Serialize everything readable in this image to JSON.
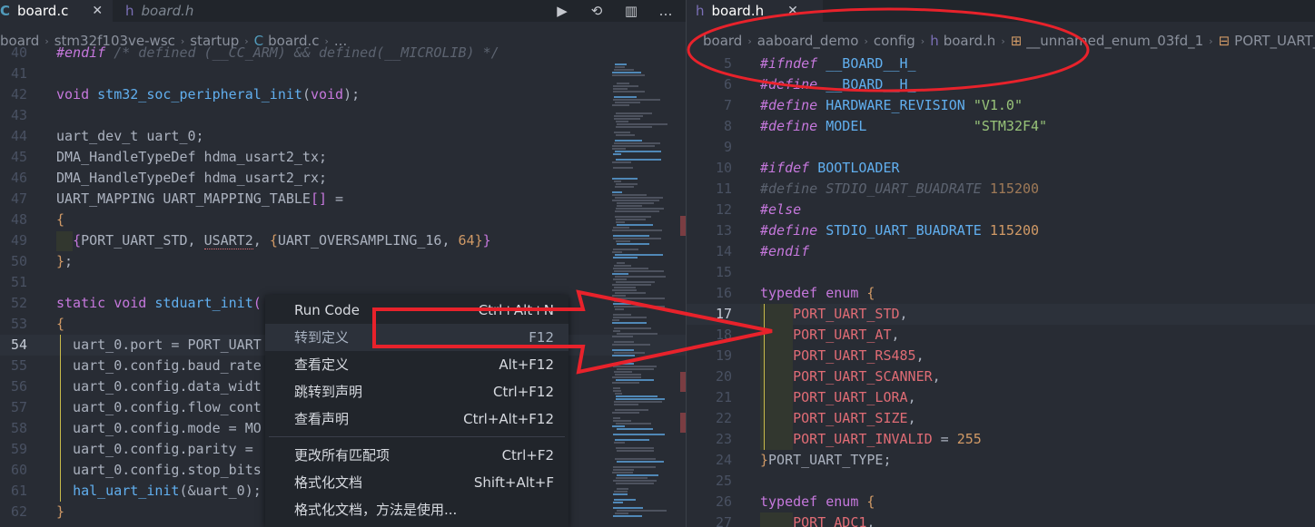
{
  "left": {
    "tabs": [
      {
        "name": "board.c",
        "icon": "C",
        "active": true,
        "close": "✕"
      },
      {
        "name": "board.h",
        "icon": "h",
        "active": false
      }
    ],
    "actions": [
      "▶",
      "⟲",
      "▥",
      "…"
    ],
    "breadcrumb": [
      "board",
      "stm32f103ve-wsc",
      "startup",
      "C",
      "board.c",
      "..."
    ],
    "lines": [
      {
        "n": "40",
        "tokens": [
          [
            "pp",
            "#endif"
          ],
          [
            "cm",
            " /* defined (__CC_ARM) && defined(__MICROLIB) */"
          ]
        ]
      },
      {
        "n": "41",
        "tokens": []
      },
      {
        "n": "42",
        "tokens": [
          [
            "kw",
            "void"
          ],
          [
            "pn",
            " "
          ],
          [
            "fn",
            "stm32_soc_peripheral_init"
          ],
          [
            "pn",
            "("
          ],
          [
            "kw",
            "void"
          ],
          [
            "pn",
            ");"
          ]
        ]
      },
      {
        "n": "43",
        "tokens": []
      },
      {
        "n": "44",
        "tokens": [
          [
            "pn",
            "uart_dev_t uart_0;"
          ]
        ]
      },
      {
        "n": "45",
        "tokens": [
          [
            "pn",
            "DMA_HandleTypeDef hdma_usart2_tx;"
          ]
        ]
      },
      {
        "n": "46",
        "tokens": [
          [
            "pn",
            "DMA_HandleTypeDef hdma_usart2_rx;"
          ]
        ]
      },
      {
        "n": "47",
        "tokens": [
          [
            "pn",
            "UART_MAPPING UART_MAPPING_TABLE"
          ],
          [
            "br",
            "[]"
          ],
          [
            "pn",
            " ="
          ]
        ]
      },
      {
        "n": "48",
        "tokens": [
          [
            "br2",
            "{"
          ]
        ]
      },
      {
        "n": "49",
        "tokens": [
          [
            "pn",
            "  "
          ],
          [
            "br",
            "{"
          ],
          [
            "pn",
            "PORT_UART_STD, "
          ],
          [
            "sq",
            "USART2"
          ],
          [
            "pn",
            ", "
          ],
          [
            "br2",
            "{"
          ],
          [
            "pn",
            "UART_OVERSAMPLING_16, "
          ],
          [
            "num",
            "64"
          ],
          [
            "br2",
            "}"
          ],
          [
            "br",
            "}"
          ]
        ]
      },
      {
        "n": "50",
        "tokens": [
          [
            "br2",
            "}"
          ],
          [
            "pn",
            ";"
          ]
        ]
      },
      {
        "n": "51",
        "tokens": []
      },
      {
        "n": "52",
        "tokens": [
          [
            "kw",
            "static"
          ],
          [
            "pn",
            " "
          ],
          [
            "kw",
            "void"
          ],
          [
            "pn",
            " "
          ],
          [
            "fn",
            "stduart_init"
          ],
          [
            "br",
            "("
          ]
        ]
      },
      {
        "n": "53",
        "tokens": [
          [
            "br2",
            "{"
          ]
        ]
      },
      {
        "n": "54",
        "tokens": [
          [
            "pn",
            "  uart_0.port = PORT_UART"
          ]
        ],
        "cur": true
      },
      {
        "n": "55",
        "tokens": [
          [
            "pn",
            "  uart_0.config.baud_rate"
          ]
        ]
      },
      {
        "n": "56",
        "tokens": [
          [
            "pn",
            "  uart_0.config.data_widt"
          ]
        ]
      },
      {
        "n": "57",
        "tokens": [
          [
            "pn",
            "  uart_0.config.flow_cont"
          ]
        ]
      },
      {
        "n": "58",
        "tokens": [
          [
            "pn",
            "  uart_0.config.mode = MO"
          ]
        ]
      },
      {
        "n": "59",
        "tokens": [
          [
            "pn",
            "  uart_0.config.parity = "
          ]
        ]
      },
      {
        "n": "60",
        "tokens": [
          [
            "pn",
            "  uart_0.config.stop_bits"
          ]
        ]
      },
      {
        "n": "61",
        "tokens": [
          [
            "pn",
            "  "
          ],
          [
            "fn",
            "hal_uart_init"
          ],
          [
            "pn",
            "(&uart_0);"
          ]
        ]
      },
      {
        "n": "62",
        "tokens": [
          [
            "br2",
            "}"
          ]
        ]
      }
    ]
  },
  "menu": {
    "items": [
      {
        "label": "Run Code",
        "key": "Ctrl+Alt+N"
      },
      {
        "label": "转到定义",
        "key": "F12",
        "selected": true
      },
      {
        "label": "查看定义",
        "key": "Alt+F12"
      },
      {
        "label": "跳转到声明",
        "key": "Ctrl+F12"
      },
      {
        "label": "查看声明",
        "key": "Ctrl+Alt+F12"
      },
      {
        "sep": true
      },
      {
        "label": "更改所有匹配项",
        "key": "Ctrl+F2"
      },
      {
        "label": "格式化文档",
        "key": "Shift+Alt+F"
      },
      {
        "label": "格式化文档，方法是使用...",
        "key": ""
      }
    ]
  },
  "right": {
    "tab": {
      "name": "board.h",
      "icon": "h",
      "close": "✕"
    },
    "breadcrumb": [
      "board",
      "aaboard_demo",
      "config",
      "h",
      "board.h",
      "⊞",
      "__unnamed_enum_03fd_1",
      "⊟",
      "PORT_UART_STD"
    ],
    "lines": [
      {
        "n": "5",
        "tokens": [
          [
            "pp",
            "#ifndef"
          ],
          [
            "pn",
            " "
          ],
          [
            "fn",
            "__BOARD__H_"
          ]
        ]
      },
      {
        "n": "6",
        "tokens": [
          [
            "pp",
            "#define"
          ],
          [
            "pn",
            " "
          ],
          [
            "fn",
            "__BOARD__H_"
          ]
        ]
      },
      {
        "n": "7",
        "tokens": [
          [
            "pp",
            "#define"
          ],
          [
            "pn",
            " "
          ],
          [
            "fn",
            "HARDWARE_REVISION"
          ],
          [
            "pn",
            " "
          ],
          [
            "str",
            "\"V1.0\""
          ]
        ]
      },
      {
        "n": "8",
        "tokens": [
          [
            "pp",
            "#define"
          ],
          [
            "pn",
            " "
          ],
          [
            "fn",
            "MODEL"
          ],
          [
            "pn",
            "             "
          ],
          [
            "str",
            "\"STM32F4\""
          ]
        ]
      },
      {
        "n": "9",
        "tokens": []
      },
      {
        "n": "10",
        "tokens": [
          [
            "pp",
            "#ifdef"
          ],
          [
            "pn",
            " "
          ],
          [
            "fn",
            "BOOTLOADER"
          ]
        ]
      },
      {
        "n": "11",
        "tokens": [
          [
            "cmpp",
            "#define STDIO_UART_BUADRATE "
          ],
          [
            "cmnum",
            "115200"
          ]
        ]
      },
      {
        "n": "12",
        "tokens": [
          [
            "pp",
            "#else"
          ]
        ]
      },
      {
        "n": "13",
        "tokens": [
          [
            "pp",
            "#define"
          ],
          [
            "pn",
            " "
          ],
          [
            "fn",
            "STDIO_UART_BUADRATE"
          ],
          [
            "pn",
            " "
          ],
          [
            "num",
            "115200"
          ]
        ]
      },
      {
        "n": "14",
        "tokens": [
          [
            "pp",
            "#endif"
          ]
        ]
      },
      {
        "n": "15",
        "tokens": []
      },
      {
        "n": "16",
        "tokens": [
          [
            "kw",
            "typedef"
          ],
          [
            "pn",
            " "
          ],
          [
            "kw",
            "enum"
          ],
          [
            "pn",
            " "
          ],
          [
            "br2",
            "{"
          ]
        ]
      },
      {
        "n": "17",
        "tokens": [
          [
            "pn",
            "    "
          ],
          [
            "en",
            "PORT_UART_STD"
          ],
          [
            "pn",
            ","
          ]
        ],
        "cur": true
      },
      {
        "n": "18",
        "tokens": [
          [
            "pn",
            "    "
          ],
          [
            "en",
            "PORT_UART_AT"
          ],
          [
            "pn",
            ","
          ]
        ]
      },
      {
        "n": "19",
        "tokens": [
          [
            "pn",
            "    "
          ],
          [
            "en",
            "PORT_UART_RS485"
          ],
          [
            "pn",
            ","
          ]
        ]
      },
      {
        "n": "20",
        "tokens": [
          [
            "pn",
            "    "
          ],
          [
            "en",
            "PORT_UART_SCANNER"
          ],
          [
            "pn",
            ","
          ]
        ]
      },
      {
        "n": "21",
        "tokens": [
          [
            "pn",
            "    "
          ],
          [
            "en",
            "PORT_UART_LORA"
          ],
          [
            "pn",
            ","
          ]
        ]
      },
      {
        "n": "22",
        "tokens": [
          [
            "pn",
            "    "
          ],
          [
            "en",
            "PORT_UART_SIZE"
          ],
          [
            "pn",
            ","
          ]
        ]
      },
      {
        "n": "23",
        "tokens": [
          [
            "pn",
            "    "
          ],
          [
            "en",
            "PORT_UART_INVALID"
          ],
          [
            "pn",
            " = "
          ],
          [
            "num",
            "255"
          ]
        ]
      },
      {
        "n": "24",
        "tokens": [
          [
            "br2",
            "}"
          ],
          [
            "pn",
            "PORT_UART_TYPE;"
          ]
        ]
      },
      {
        "n": "25",
        "tokens": []
      },
      {
        "n": "26",
        "tokens": [
          [
            "kw",
            "typedef"
          ],
          [
            "pn",
            " "
          ],
          [
            "kw",
            "enum"
          ],
          [
            "pn",
            " "
          ],
          [
            "br2",
            "{"
          ]
        ]
      },
      {
        "n": "27",
        "tokens": [
          [
            "pn",
            "    "
          ],
          [
            "en",
            "PORT_ADC1"
          ],
          [
            "pn",
            ","
          ]
        ]
      }
    ]
  },
  "colors": {
    "annotation": "#e8222b",
    "background": "#282c34"
  }
}
